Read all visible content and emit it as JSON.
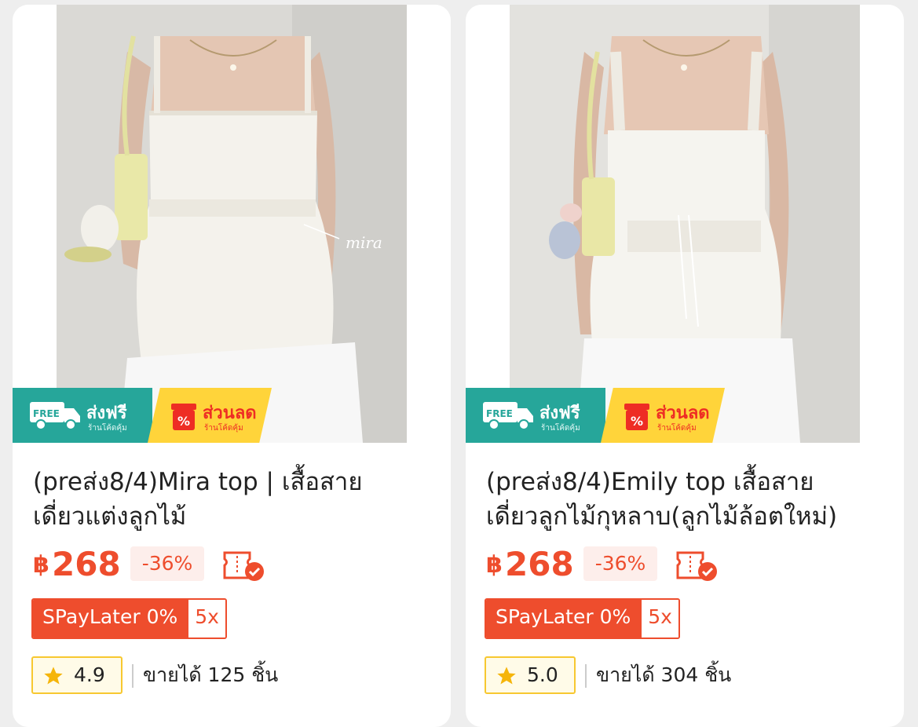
{
  "colors": {
    "price": "#ee4d2d",
    "free_shipping_badge": "#26a69a",
    "discount_badge": "#ffd43a",
    "rating_border": "#f7c830"
  },
  "products": [
    {
      "title_line1": "(preส่ง8/4)Mira top | เสื้อสาย",
      "title_line2": "เดี่ยวแต่งลูกไม้",
      "currency": "฿",
      "price": "268",
      "discount": "-36%",
      "spaylater": "SPayLater 0%",
      "installments": "5x",
      "rating": "4.9",
      "sold": "ขายได้ 125 ชิ้น",
      "badge_free_main": "ส่งฟรี",
      "badge_free_label": "FREE",
      "badge_free_sub": "ร้านโค้ดคุ้ม",
      "badge_disc_main": "ส่วนลด",
      "badge_disc_sub": "ร้านโค้ดคุ้ม",
      "image_watermark": "mira",
      "image_icon": "product-photo"
    },
    {
      "title_line1": "(preส่ง8/4)Emily top เสื้อสาย",
      "title_line2": "เดี่ยวลูกไม้กุหลาบ(ลูกไม้ล้อตใหม่)",
      "currency": "฿",
      "price": "268",
      "discount": "-36%",
      "spaylater": "SPayLater 0%",
      "installments": "5x",
      "rating": "5.0",
      "sold": "ขายได้ 304 ชิ้น",
      "badge_free_main": "ส่งฟรี",
      "badge_free_label": "FREE",
      "badge_free_sub": "ร้านโค้ดคุ้ม",
      "badge_disc_main": "ส่วนลด",
      "badge_disc_sub": "ร้านโค้ดคุ้ม",
      "image_icon": "product-photo"
    }
  ]
}
